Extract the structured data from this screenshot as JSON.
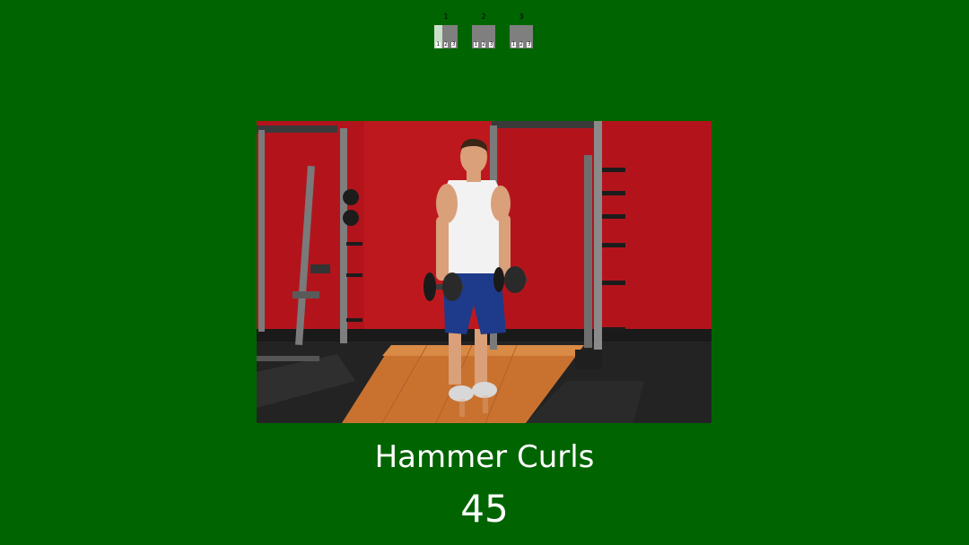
{
  "colors": {
    "background": "#006400",
    "text": "#ffffff",
    "set_box": "#7f7f7f",
    "set_progress": "#c9dfc9"
  },
  "sets": [
    {
      "label": "1",
      "reps": [
        "1",
        "2",
        "3"
      ],
      "progress": 0.35
    },
    {
      "label": "2",
      "reps": [
        "1",
        "2",
        "3"
      ],
      "progress": 0
    },
    {
      "label": "3",
      "reps": [
        "1",
        "2",
        "3"
      ],
      "progress": 0
    }
  ],
  "exercise": {
    "title": "Hammer Curls",
    "counter": "45"
  }
}
